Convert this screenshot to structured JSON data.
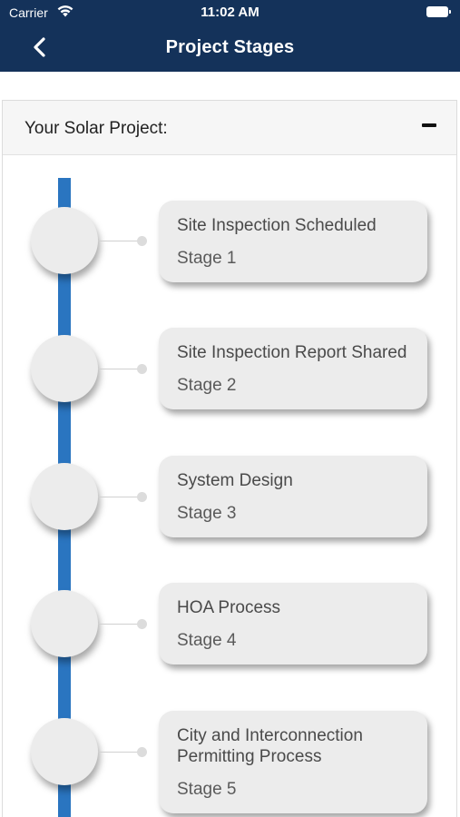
{
  "status_bar": {
    "carrier": "Carrier",
    "time": "11:02 AM"
  },
  "nav": {
    "title": "Project Stages",
    "back_icon": "chevron-left-icon"
  },
  "panel": {
    "label": "Your Solar Project:",
    "collapse_icon": "minus-icon"
  },
  "colors": {
    "nav_background": "#14325a",
    "timeline": "#2a75c0",
    "card_background": "#ececec"
  },
  "stages": [
    {
      "title": "Site Inspection Scheduled",
      "stage": "Stage 1"
    },
    {
      "title": "Site Inspection Report Shared",
      "stage": "Stage 2"
    },
    {
      "title": "System Design",
      "stage": "Stage 3"
    },
    {
      "title": "HOA Process",
      "stage": "Stage 4"
    },
    {
      "title": "City and Interconnection Permitting Process",
      "stage": "Stage 5"
    }
  ]
}
